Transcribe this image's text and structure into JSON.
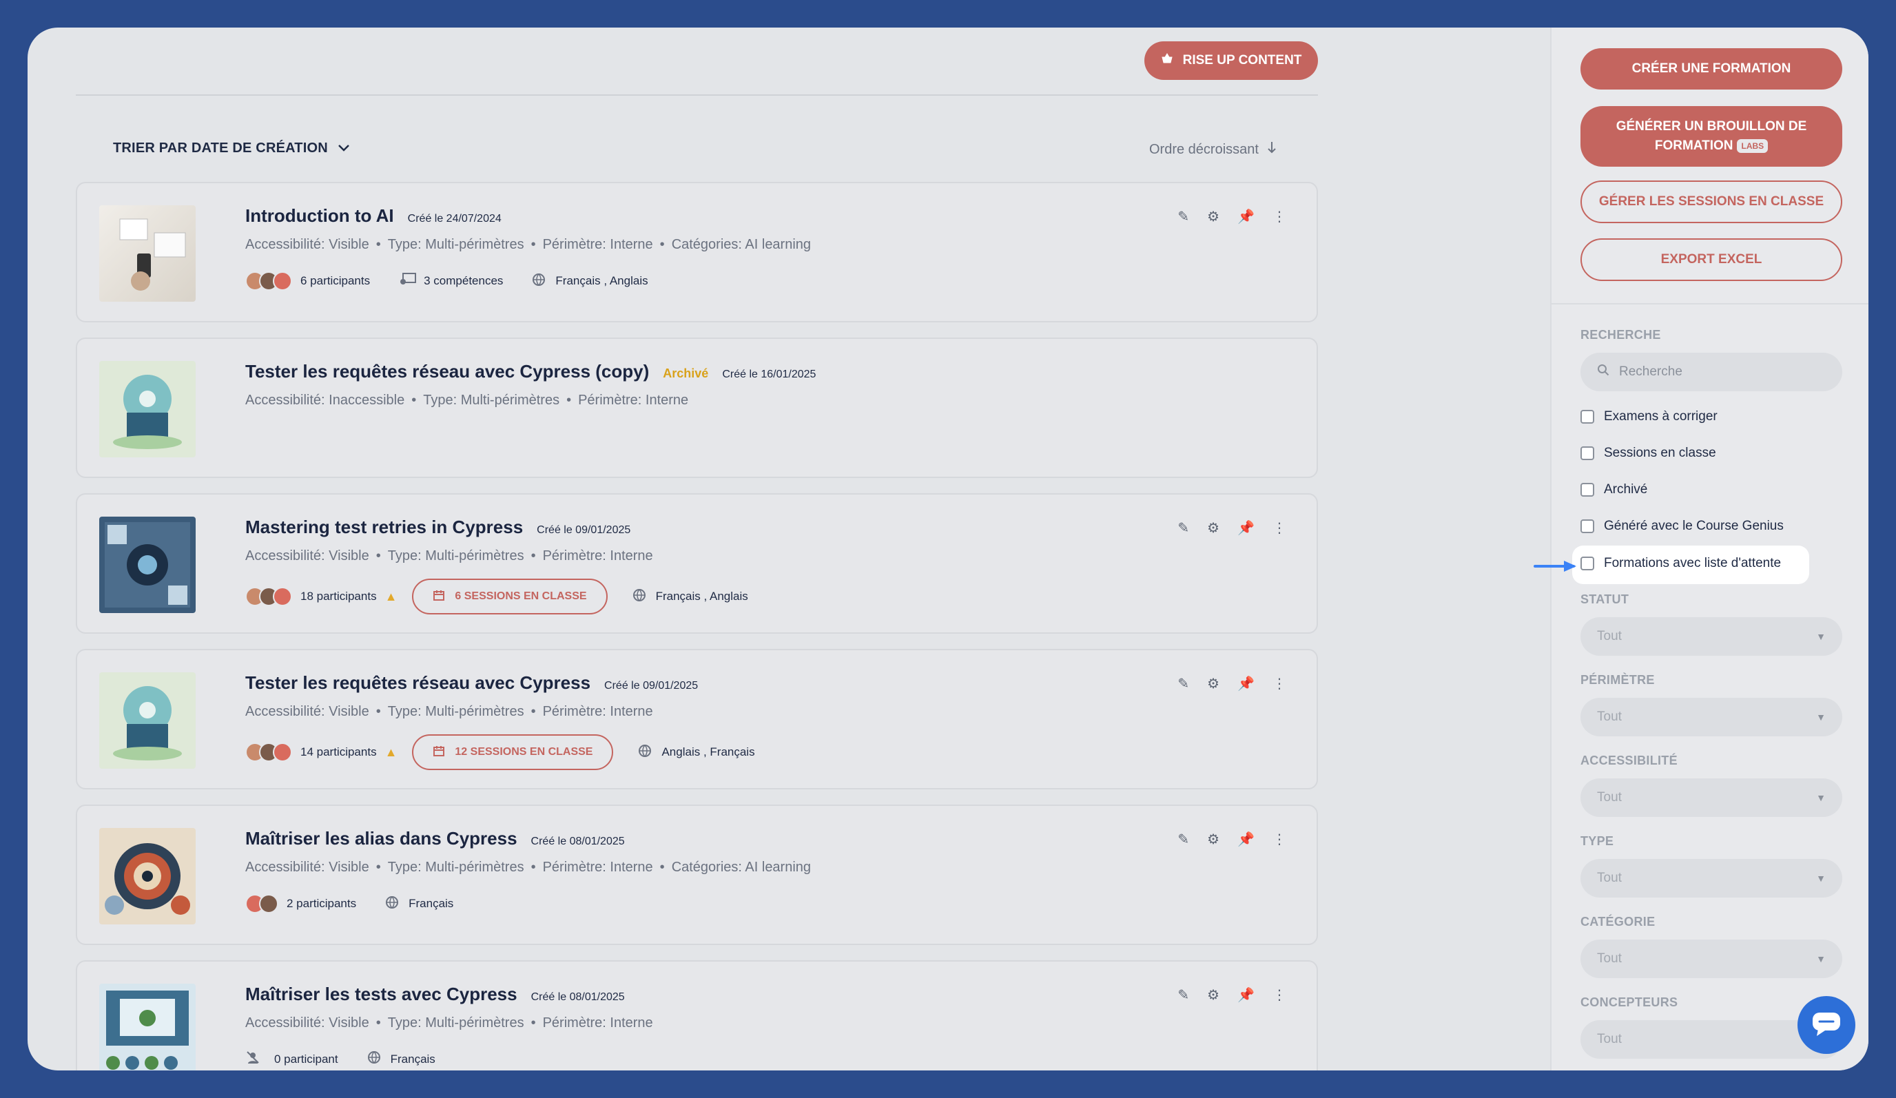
{
  "toolbar": {
    "rise_label": "RISE UP CONTENT"
  },
  "sort": {
    "label": "TRIER PAR DATE DE CRÉATION",
    "order": "Ordre décroissant"
  },
  "courses": [
    {
      "title": "Introduction to AI",
      "status": "",
      "created": "Créé le 24/07/2024",
      "meta": [
        "Accessibilité: Visible",
        "Type: Multi-périmètres",
        "Périmètre: Interne",
        "Catégories: AI learning"
      ],
      "participants": "6 participants",
      "warning": false,
      "competences": "3 compétences",
      "sessions": "",
      "languages": "Français , Anglais",
      "pinned": true
    },
    {
      "title": "Tester les requêtes réseau avec Cypress (copy)",
      "status": "Archivé",
      "created": "Créé le 16/01/2025",
      "meta": [
        "Accessibilité: Inaccessible",
        "Type: Multi-périmètres",
        "Périmètre: Interne"
      ],
      "participants": "",
      "warning": false,
      "competences": "",
      "sessions": "",
      "languages": "",
      "pinned": false
    },
    {
      "title": "Mastering test retries in Cypress",
      "status": "",
      "created": "Créé le 09/01/2025",
      "meta": [
        "Accessibilité: Visible",
        "Type: Multi-périmètres",
        "Périmètre: Interne"
      ],
      "participants": "18 participants",
      "warning": true,
      "competences": "",
      "sessions": "6 SESSIONS EN CLASSE",
      "languages": "Français , Anglais",
      "pinned": false
    },
    {
      "title": "Tester les requêtes réseau avec Cypress",
      "status": "",
      "created": "Créé le 09/01/2025",
      "meta": [
        "Accessibilité: Visible",
        "Type: Multi-périmètres",
        "Périmètre: Interne"
      ],
      "participants": "14 participants",
      "warning": true,
      "competences": "",
      "sessions": "12 SESSIONS EN CLASSE",
      "languages": "Anglais , Français",
      "pinned": false
    },
    {
      "title": "Maîtriser les alias dans Cypress",
      "status": "",
      "created": "Créé le 08/01/2025",
      "meta": [
        "Accessibilité: Visible",
        "Type: Multi-périmètres",
        "Périmètre: Interne",
        "Catégories: AI learning"
      ],
      "participants": "2 participants",
      "warning": false,
      "competences": "",
      "sessions": "",
      "languages": "Français",
      "pinned": false
    },
    {
      "title": "Maîtriser les tests avec Cypress",
      "status": "",
      "created": "Créé le 08/01/2025",
      "meta": [
        "Accessibilité: Visible",
        "Type: Multi-périmètres",
        "Périmètre: Interne"
      ],
      "participants": "0 participant",
      "warning": false,
      "competences": "",
      "sessions": "",
      "languages": "Français",
      "pinned": false
    }
  ],
  "sidebar": {
    "create": "CRÉER UNE FORMATION",
    "generate": "GÉNÉRER UN BROUILLON DE FORMATION",
    "labs": "LABS",
    "manage_sessions": "GÉRER LES SESSIONS EN CLASSE",
    "export": "EXPORT EXCEL",
    "search_label": "RECHERCHE",
    "search_placeholder": "Recherche",
    "checks": [
      "Examens à corriger",
      "Sessions en classe",
      "Archivé",
      "Généré avec le Course Genius",
      "Formations avec liste d'attente"
    ],
    "filters": [
      {
        "label": "STATUT",
        "value": "Tout"
      },
      {
        "label": "PÉRIMÈTRE",
        "value": "Tout"
      },
      {
        "label": "ACCESSIBILITÉ",
        "value": "Tout"
      },
      {
        "label": "TYPE",
        "value": "Tout"
      },
      {
        "label": "CATÉGORIE",
        "value": "Tout"
      },
      {
        "label": "CONCEPTEURS",
        "value": "Tout"
      }
    ]
  },
  "colors": {
    "accent": "#c4655f",
    "background": "#2b4c8c",
    "chat": "#2d6fd8",
    "archived": "#d9a21b",
    "arrow": "#3b82f6"
  }
}
